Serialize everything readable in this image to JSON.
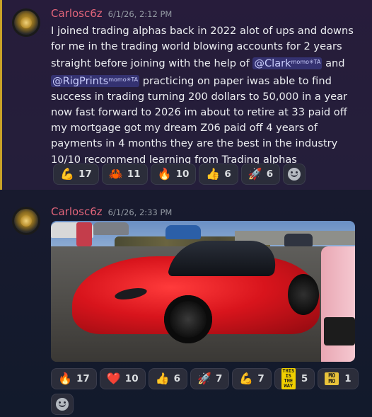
{
  "messages": [
    {
      "username": "Carlosc6z",
      "timestamp": "6/1/26, 2:12 PM",
      "text_part1": "I joined trading alphas back in 2022 alot of ups and downs for me in the trading world blowing accounts for 2 years straight before joining with the help of ",
      "mention1": "@Clark",
      "mention1_sup": "momo✳TA",
      "text_part2": " and ",
      "mention2": "@RigPrints",
      "mention2_sup": "momo✳TA",
      "text_part3": " practicing on paper iwas able to find success in trading turning 200 dollars to 50,000 in a year now fast forward to 2026 im about to retire at 33 paid off my mortgage got my dream Z06  paid  off 4 years of payments in 4 months they are the best in the industry 10/10 recommend learning from Trading alphas",
      "reactions": [
        {
          "emoji": "💪",
          "icon": "flexed-biceps-icon",
          "count": "17"
        },
        {
          "emoji": "🦀",
          "icon": "figure-emoji-icon",
          "count": "11"
        },
        {
          "emoji": "🔥",
          "icon": "fire-icon",
          "count": "10"
        },
        {
          "emoji": "👍",
          "icon": "thumbs-up-icon",
          "count": "6"
        },
        {
          "emoji": "🚀",
          "icon": "rocket-icon",
          "count": "6"
        }
      ]
    },
    {
      "username": "Carlosc6z",
      "timestamp": "6/1/26, 2:33 PM",
      "attachment": "red-corvette-photo",
      "reactions": [
        {
          "emoji": "🔥",
          "icon": "fire-icon",
          "count": "17"
        },
        {
          "emoji": "❤️",
          "icon": "red-heart-icon",
          "count": "10"
        },
        {
          "emoji": "👍",
          "icon": "thumbs-up-icon",
          "count": "6"
        },
        {
          "emoji": "🚀",
          "icon": "rocket-icon",
          "count": "7"
        },
        {
          "emoji": "💪",
          "icon": "flexed-biceps-icon",
          "count": "7"
        },
        {
          "emoji": "THIS IS THE WAY",
          "icon": "this-is-the-way-icon",
          "count": "5"
        },
        {
          "emoji": "MO MO",
          "icon": "momo-icon",
          "count": "1"
        }
      ]
    }
  ],
  "colors": {
    "username": "#e0647a",
    "highlight_bar": "#c9a227",
    "mention_bg": "#3e4a9a"
  }
}
